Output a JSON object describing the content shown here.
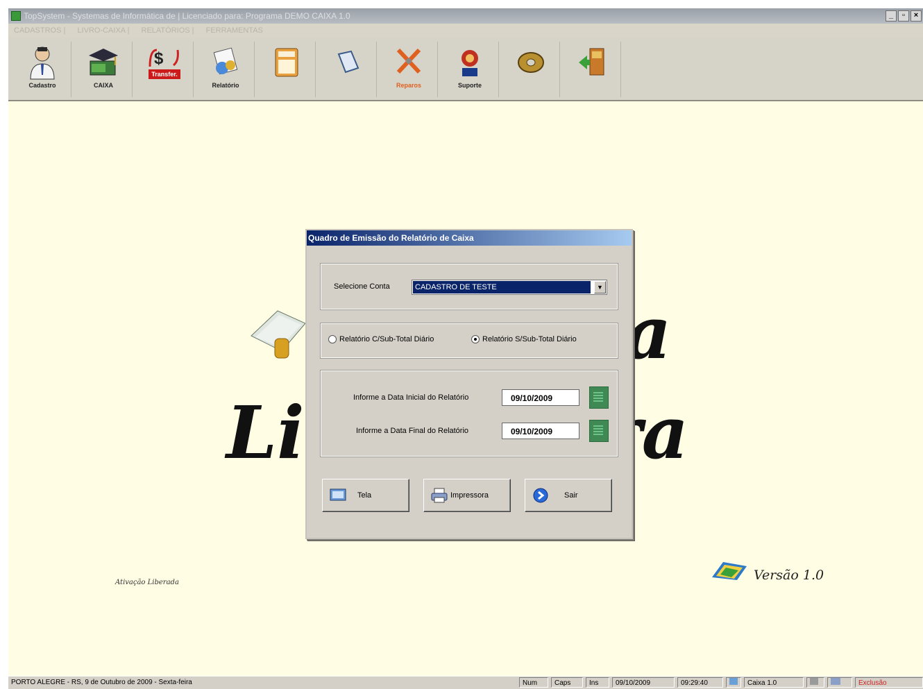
{
  "window": {
    "title": "TopSystem - Systemas de Informática de | Licenciado para: Programa DEMO CAIXA 1.0",
    "controls": [
      "_",
      "▫",
      "×"
    ]
  },
  "menu": [
    "CADASTROS |",
    "LIVRO-CAIXA |",
    "RELATÓRIOS |",
    "FERRAMENTAS"
  ],
  "toolbar": [
    {
      "label": "Cadastro",
      "icon": "person-icon"
    },
    {
      "label": "CAIXA",
      "icon": "graduation-book-icon"
    },
    {
      "label": "Transfer.",
      "icon": "money-transfer-icon"
    },
    {
      "label": "Relatório",
      "icon": "report-icon"
    },
    {
      "label": "",
      "icon": "calculator-icon"
    },
    {
      "label": "",
      "icon": "notes-icon"
    },
    {
      "label": "Reparos",
      "icon": "tools-icon"
    },
    {
      "label": "Suporte",
      "icon": "support-icon"
    },
    {
      "label": "",
      "icon": "disk-icon"
    },
    {
      "label": "",
      "icon": "exit-icon"
    }
  ],
  "background": {
    "word1_end": "a",
    "word2_start": "Li",
    "word2_end": "ra",
    "left_caption": "Ativação Liberada",
    "version": "Versão 1.0"
  },
  "dialog": {
    "title": "Quadro de Emissão do Relatório de Caixa",
    "account_label": "Selecione Conta",
    "account_value": "CADASTRO DE TESTE",
    "radio_option_1": "Relatório C/Sub-Total Diário",
    "radio_option_2": "Relatório S/Sub-Total Diário",
    "radio_selected": 2,
    "start_date_label": "Informe a Data Inicial do Relatório",
    "start_date": "09/10/2009",
    "end_date_label": "Informe a Data Final do Relatório",
    "end_date": "09/10/2009",
    "buttons": {
      "tela": "Tela",
      "impressora": "Impressora",
      "sair": "Sair"
    }
  },
  "statusbar": {
    "location": "PORTO ALEGRE - RS, 9 de Outubro de 2009 - Sexta-feira",
    "num": "Num",
    "caps": "Caps",
    "ins": "Ins",
    "date": "09/10/2009",
    "time": "09:29:40",
    "app": "Caixa 1.0",
    "status": "Exclusão"
  },
  "colors": {
    "background": "#fffde4",
    "dialog_title": "#0a246a",
    "selection": "#0a246a",
    "status_red": "#cc2222"
  }
}
